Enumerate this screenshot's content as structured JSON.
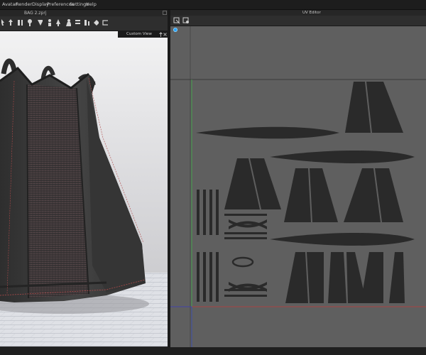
{
  "menu": {
    "items": [
      "Avatar",
      "Render",
      "Display",
      "Preferences",
      "Settings",
      "Help"
    ]
  },
  "viewport3d": {
    "file_title": "BAG 2.zprj",
    "custom_view_label": "Custom View"
  },
  "uv_editor": {
    "title": "UV Editor"
  },
  "icons": {
    "toolbar": [
      "select-icon",
      "move-icon",
      "rotate-icon",
      "pin-icon",
      "fold-icon",
      "stitch-icon",
      "sewing-icon",
      "avatar-icon",
      "arrange-icon",
      "mesh-icon",
      "transform-icon",
      "edit-icon"
    ],
    "uv_toolbar": [
      "uv-select-icon",
      "uv-transform-icon"
    ],
    "marker": "blue-dot-marker-icon"
  },
  "colors": {
    "uv_background": "#5f5f5f",
    "uv_piece": "#2a2a2a",
    "axis_red": "#c03a3a",
    "axis_green": "#3fb24a",
    "axis_blue": "#3a3ac0",
    "bag": "#3c3c3c",
    "stitch": "#b04a4a"
  }
}
